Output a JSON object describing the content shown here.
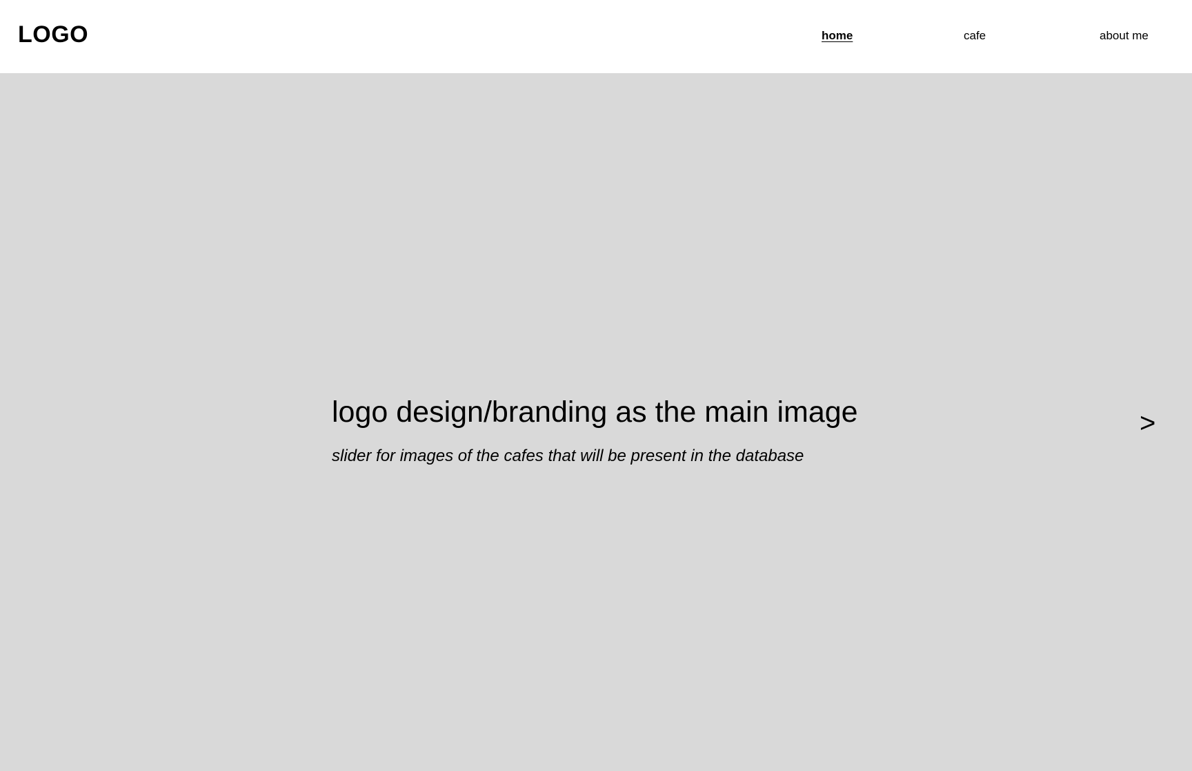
{
  "header": {
    "logo_text": "LOGO",
    "nav": {
      "home": "home",
      "cafe": "cafe",
      "about": "about me"
    }
  },
  "hero": {
    "title": "logo design/branding as the main image",
    "subtitle": "slider for images of the cafes that will be present in the database",
    "next_arrow": ">"
  },
  "colors": {
    "hero_background": "#d9d9d9",
    "header_background": "#ffffff",
    "text": "#000000"
  }
}
